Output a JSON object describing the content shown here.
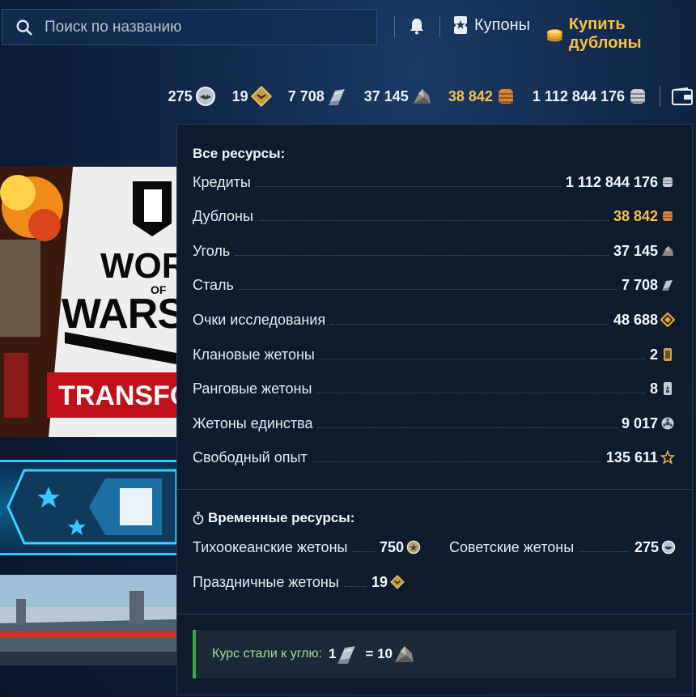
{
  "search": {
    "placeholder": "Поиск по названию"
  },
  "header": {
    "coupons_label": "Купоны",
    "buy_doubloons_label": "Купить дублоны"
  },
  "currencies": [
    {
      "value": "275",
      "icon": "soviet-token-icon"
    },
    {
      "value": "19",
      "icon": "holiday-token-icon"
    },
    {
      "value": "7 708",
      "icon": "steel-icon"
    },
    {
      "value": "37 145",
      "icon": "coal-icon"
    },
    {
      "value": "38 842",
      "icon": "doubloon-icon",
      "color": "#f4bf55"
    },
    {
      "value": "1 112 844 176",
      "icon": "credits-icon"
    }
  ],
  "popup": {
    "all_title": "Все ресурсы:",
    "resources": [
      {
        "name": "Кредиты",
        "value": "1 112 844 176",
        "icon": "credits-icon"
      },
      {
        "name": "Дублоны",
        "value": "38 842",
        "icon": "doubloon-icon",
        "color": "#f4bf55"
      },
      {
        "name": "Уголь",
        "value": "37 145",
        "icon": "coal-icon"
      },
      {
        "name": "Сталь",
        "value": "7 708",
        "icon": "steel-icon"
      },
      {
        "name": "Очки исследования",
        "value": "48 688",
        "icon": "research-points-icon"
      },
      {
        "name": "Клановые жетоны",
        "value": "2",
        "icon": "clan-token-icon"
      },
      {
        "name": "Ранговые жетоны",
        "value": "8",
        "icon": "ranked-token-icon"
      },
      {
        "name": "Жетоны единства",
        "value": "9 017",
        "icon": "unity-token-icon"
      },
      {
        "name": "Свободный опыт",
        "value": "135 611",
        "icon": "free-xp-star-icon"
      }
    ],
    "temp_title": "Временные ресурсы:",
    "temp_resources": [
      {
        "name": "Тихоокеанские жетоны",
        "value": "750",
        "icon": "pacific-token-icon"
      },
      {
        "name": "Советские жетоны",
        "value": "275",
        "icon": "soviet-token-icon"
      },
      {
        "name": "Праздничные жетоны",
        "value": "19",
        "icon": "holiday-token-icon"
      }
    ],
    "rate": {
      "label": "Курс стали к углю:",
      "left": "1",
      "right": "= 10"
    }
  },
  "banner": {
    "logo_line1": "WORLD",
    "logo_line2": "OF",
    "logo_line3": "WARSHIPS",
    "strip": "TRANSFORMERS"
  },
  "colors": {
    "gold": "#f4bf55",
    "accent_green": "#3fa94a",
    "popup_bg": "#0f1c2e"
  }
}
